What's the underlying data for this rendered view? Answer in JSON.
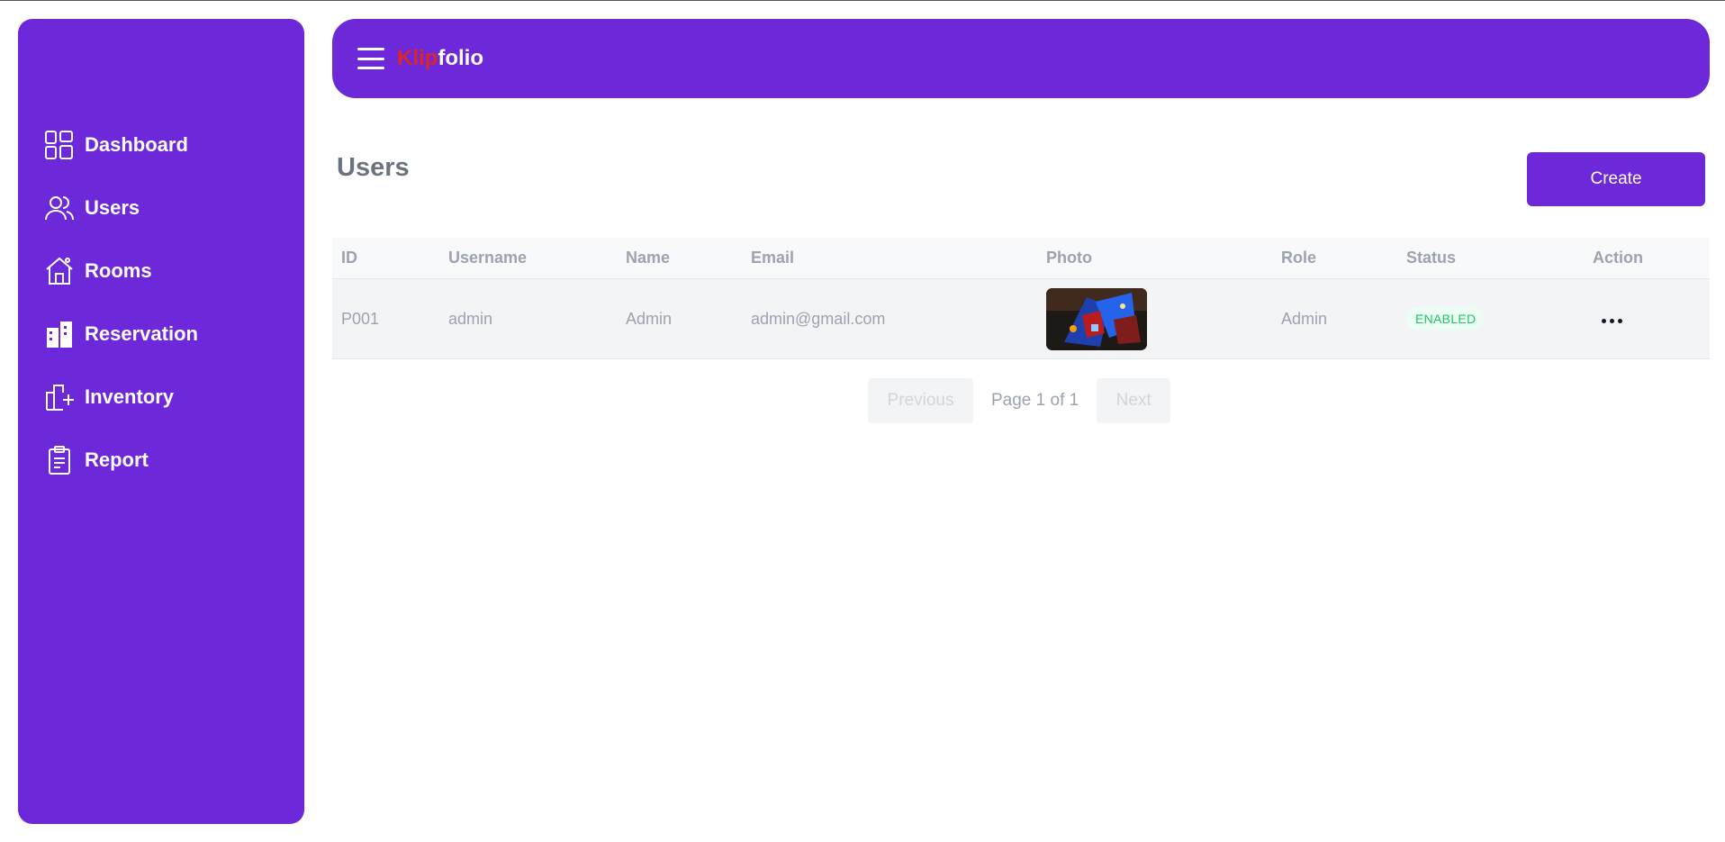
{
  "brand": {
    "part1": "Klip",
    "part2": "folio",
    "color_part1": "#dc2626",
    "color_part2": "#ffffff"
  },
  "theme": {
    "accent": "#6d28d9",
    "status_enabled": "#22c55e"
  },
  "sidebar": {
    "items": [
      {
        "label": "Dashboard",
        "icon": "dashboard-icon"
      },
      {
        "label": "Users",
        "icon": "users-icon"
      },
      {
        "label": "Rooms",
        "icon": "house-icon"
      },
      {
        "label": "Reservation",
        "icon": "building-icon"
      },
      {
        "label": "Inventory",
        "icon": "inventory-add-icon"
      },
      {
        "label": "Report",
        "icon": "clipboard-icon"
      }
    ]
  },
  "page": {
    "title": "Users",
    "create_label": "Create"
  },
  "table": {
    "headers": [
      "ID",
      "Username",
      "Name",
      "Email",
      "Photo",
      "Role",
      "Status",
      "Action"
    ],
    "rows": [
      {
        "id": "P001",
        "username": "admin",
        "name": "Admin",
        "email": "admin@gmail.com",
        "photo": "user-photo-thumbnail",
        "role": "Admin",
        "status": "ENABLED",
        "action": "more-options-icon"
      }
    ]
  },
  "pagination": {
    "previous": "Previous",
    "info": "Page 1 of 1",
    "next": "Next"
  }
}
